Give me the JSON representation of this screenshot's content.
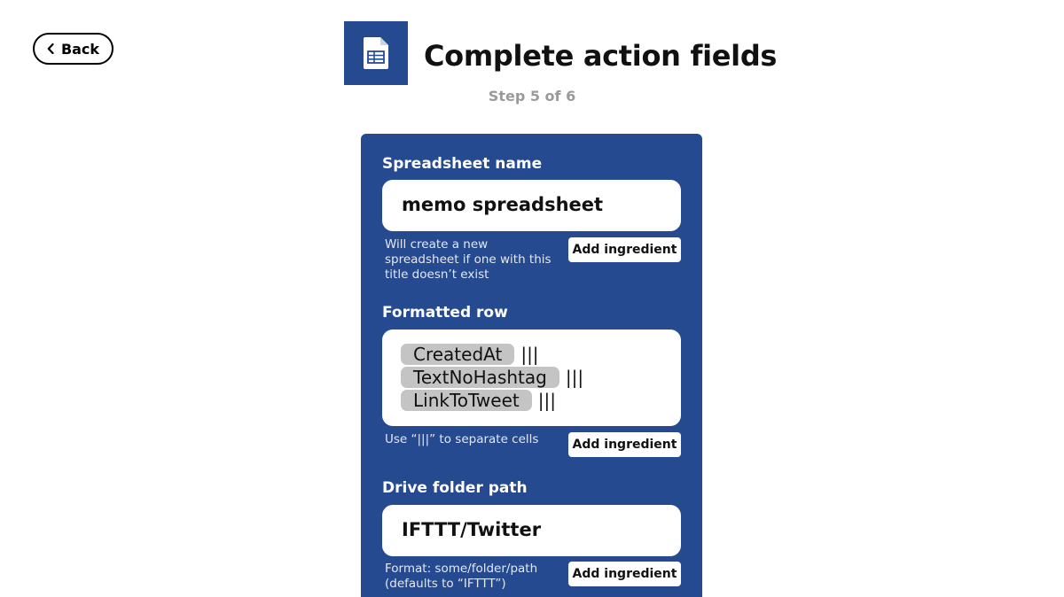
{
  "header": {
    "back_label": "Back",
    "title": "Complete action fields",
    "step": "Step 5 of 6",
    "service_icon": "spreadsheet-icon",
    "brand_color": "#264a8f"
  },
  "fields": [
    {
      "label": "Spreadsheet name",
      "value": "memo spreadsheet",
      "help": "Will create a new spreadsheet if one with this title doesn’t exist",
      "button": "Add ingredient"
    },
    {
      "label": "Formatted row",
      "ingredients": [
        {
          "name": "CreatedAt",
          "separator": "|||"
        },
        {
          "name": "TextNoHashtag",
          "separator": "|||"
        },
        {
          "name": "LinkToTweet",
          "separator": "|||"
        }
      ],
      "help": "Use “|||” to separate cells",
      "button": "Add ingredient"
    },
    {
      "label": "Drive folder path",
      "value": "IFTTT/Twitter",
      "help": "Format: some/folder/path (defaults to “IFTTT”)",
      "button": "Add ingredient"
    }
  ]
}
